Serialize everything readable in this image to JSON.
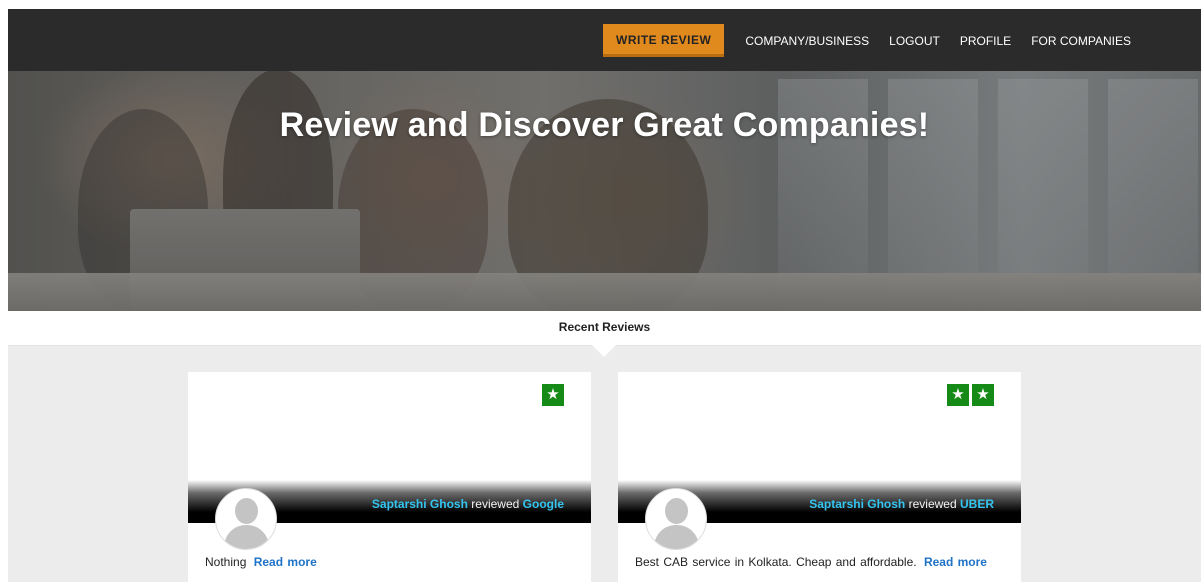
{
  "nav": {
    "write_review": "WRITE REVIEW",
    "links": [
      "COMPANY/BUSINESS",
      "LOGOUT",
      "PROFILE",
      "FOR COMPANIES"
    ]
  },
  "hero": {
    "title": "Review and Discover Great Companies!"
  },
  "recent_reviews": {
    "heading": "Recent Reviews",
    "cards": [
      {
        "rating": 1,
        "reviewer": "Saptarshi Ghosh",
        "action": "reviewed",
        "company": "Google",
        "text": "Nothing",
        "read_more": "Read more"
      },
      {
        "rating": 2,
        "reviewer": "Saptarshi Ghosh",
        "action": "reviewed",
        "company": "UBER",
        "text": "Best CAB service in Kolkata. Cheap and affordable.",
        "read_more": "Read more"
      }
    ]
  },
  "colors": {
    "accent": "#e08a1e",
    "star_green": "#168a16",
    "link_cyan": "#33c5f0",
    "link_blue": "#1f73c7"
  },
  "icons": {
    "star": "star-icon",
    "avatar": "user-avatar-icon"
  }
}
